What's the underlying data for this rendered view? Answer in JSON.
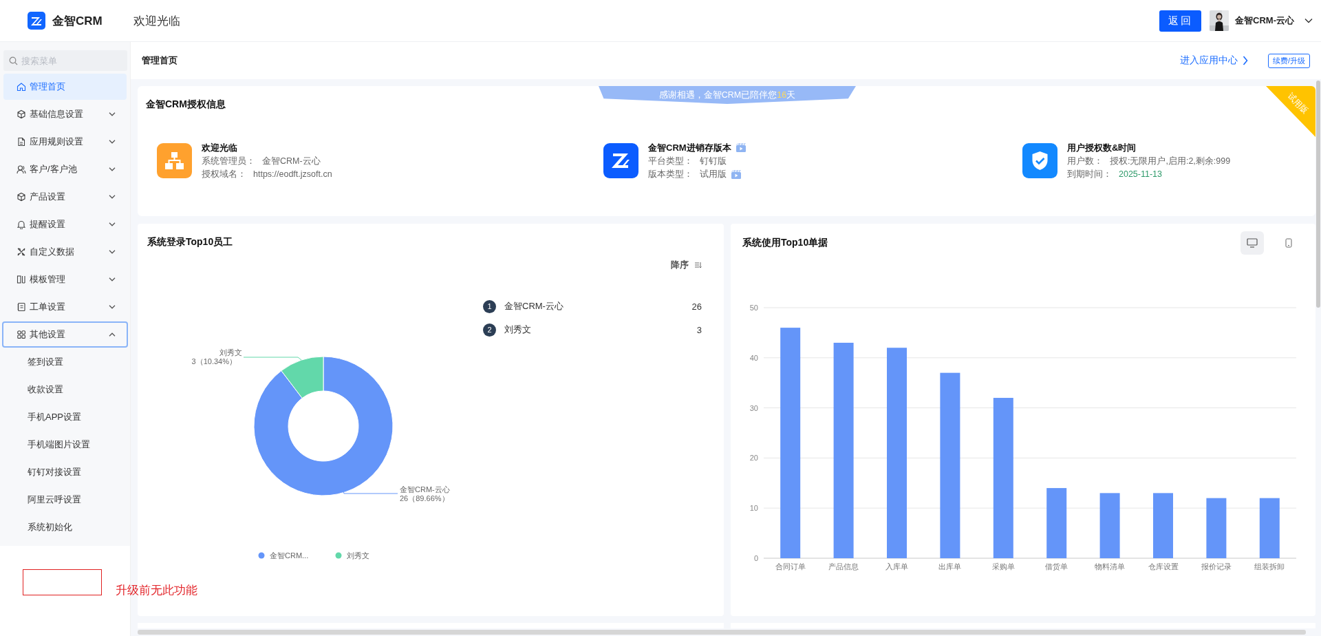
{
  "header": {
    "logo_text": "金智CRM",
    "greeting": "欢迎光临",
    "back_button": "返回",
    "user_name": "金智CRM-云心"
  },
  "sidebar": {
    "search_placeholder": "搜索菜单",
    "items": [
      {
        "label": "管理首页",
        "kind": "link",
        "selected": true,
        "focused": false
      },
      {
        "label": "基础信息设置",
        "kind": "group",
        "selected": false,
        "focused": false,
        "expanded": false
      },
      {
        "label": "应用规则设置",
        "kind": "group",
        "selected": false,
        "focused": false,
        "expanded": false
      },
      {
        "label": "客户/客户池",
        "kind": "group",
        "selected": false,
        "focused": false,
        "expanded": false
      },
      {
        "label": "产品设置",
        "kind": "group",
        "selected": false,
        "focused": false,
        "expanded": false
      },
      {
        "label": "提醒设置",
        "kind": "group",
        "selected": false,
        "focused": false,
        "expanded": false
      },
      {
        "label": "自定义数据",
        "kind": "group",
        "selected": false,
        "focused": false,
        "expanded": false
      },
      {
        "label": "模板管理",
        "kind": "group",
        "selected": false,
        "focused": false,
        "expanded": false
      },
      {
        "label": "工单设置",
        "kind": "group",
        "selected": false,
        "focused": false,
        "expanded": false
      },
      {
        "label": "其他设置",
        "kind": "group",
        "selected": false,
        "focused": true,
        "expanded": true,
        "children": [
          {
            "label": "签到设置",
            "selected": false
          },
          {
            "label": "收款设置",
            "selected": false
          },
          {
            "label": "手机APP设置",
            "selected": false
          },
          {
            "label": "手机端图片设置",
            "selected": false
          },
          {
            "label": "钉钉对接设置",
            "selected": false
          },
          {
            "label": "阿里云呼设置",
            "selected": false
          },
          {
            "label": "系统初始化",
            "selected": false
          }
        ]
      }
    ]
  },
  "breadcrumb": {
    "title": "管理首页",
    "app_center_link": "进入应用中心",
    "renew_button": "续费/升级"
  },
  "license": {
    "title": "金智CRM授权信息",
    "banner": {
      "before": "感谢相遇，金智CRM已陪伴您",
      "days": "16",
      "after": "天"
    },
    "ribbon": "试用版",
    "blocks": [
      {
        "kind": "org",
        "title": "欢迎光临",
        "title_video": false,
        "lines": [
          {
            "label": "系统管理员：",
            "value": "金智CRM-云心",
            "kind": "text",
            "video": false
          },
          {
            "label": "授权域名：",
            "value": "https://eodft.jzsoft.cn",
            "kind": "text",
            "video": false
          }
        ]
      },
      {
        "kind": "logo",
        "title": "金智CRM进销存版本",
        "title_video": true,
        "lines": [
          {
            "label": "平台类型：",
            "value": "钉钉版",
            "kind": "text",
            "video": false
          },
          {
            "label": "版本类型：",
            "value": "试用版",
            "kind": "text",
            "video": true
          }
        ]
      },
      {
        "kind": "shield",
        "title": "用户授权数&时间",
        "title_video": false,
        "lines": [
          {
            "label": "用户数：",
            "value": "授权:无限用户,启用:2,剩余:999",
            "kind": "text",
            "video": false
          },
          {
            "label": "到期时间：",
            "value": "2025-11-13",
            "kind": "date",
            "video": false
          }
        ]
      }
    ]
  },
  "login_chart": {
    "title": "系统登录Top10员工",
    "sort_label": "降序",
    "ranking": [
      {
        "rank": "1",
        "name": "金智CRM-云心",
        "count": "26"
      },
      {
        "rank": "2",
        "name": "刘秀文",
        "count": "3"
      }
    ],
    "legend": [
      "金智CRM...",
      "刘秀文"
    ],
    "chart_data": {
      "type": "donut",
      "categories": [
        "金智CRM-云心",
        "刘秀文"
      ],
      "values": [
        26,
        3
      ],
      "value_labels": [
        "26（89.66%）",
        "3（10.34%）"
      ]
    }
  },
  "usage_chart": {
    "title": "系统使用Top10单据",
    "view_toggle": [
      {
        "kind": "desktop",
        "selected": true
      },
      {
        "kind": "mobile",
        "selected": false
      }
    ],
    "chart_data": {
      "type": "bar",
      "categories": [
        "合同订单",
        "产品信息",
        "入库单",
        "出库单",
        "采购单",
        "借货单",
        "物料清单",
        "仓库设置",
        "报价记录",
        "组装拆卸"
      ],
      "series": [
        {
          "color": "#6495f9",
          "values": [
            46,
            43,
            42,
            37,
            32,
            14,
            13,
            13,
            12,
            12
          ]
        }
      ],
      "ylim": [
        0,
        50
      ],
      "yticks": [
        0,
        10,
        20,
        30,
        40,
        50
      ],
      "grid": true
    }
  },
  "annotation": {
    "text": "升级前无此功能"
  }
}
